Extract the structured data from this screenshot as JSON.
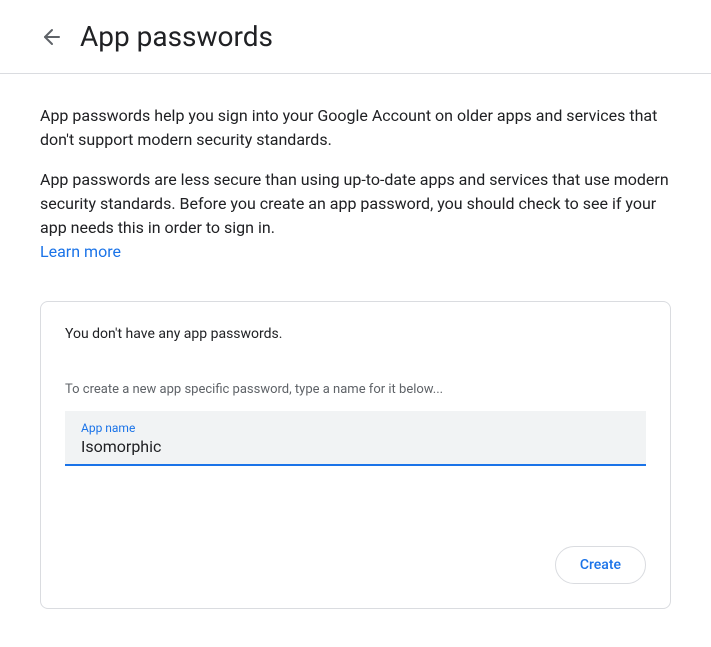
{
  "header": {
    "title": "App passwords"
  },
  "description": {
    "para1": "App passwords help you sign into your Google Account on older apps and services that don't support modern security standards.",
    "para2": "App passwords are less secure than using up-to-date apps and services that use modern security standards. Before you create an app password, you should check to see if your app needs this in order to sign in.",
    "learn_more": "Learn more"
  },
  "card": {
    "status": "You don't have any app passwords.",
    "instruction": "To create a new app specific password, type a name for it below...",
    "input_label": "App name",
    "input_value": "Isomorphic",
    "create_label": "Create"
  }
}
